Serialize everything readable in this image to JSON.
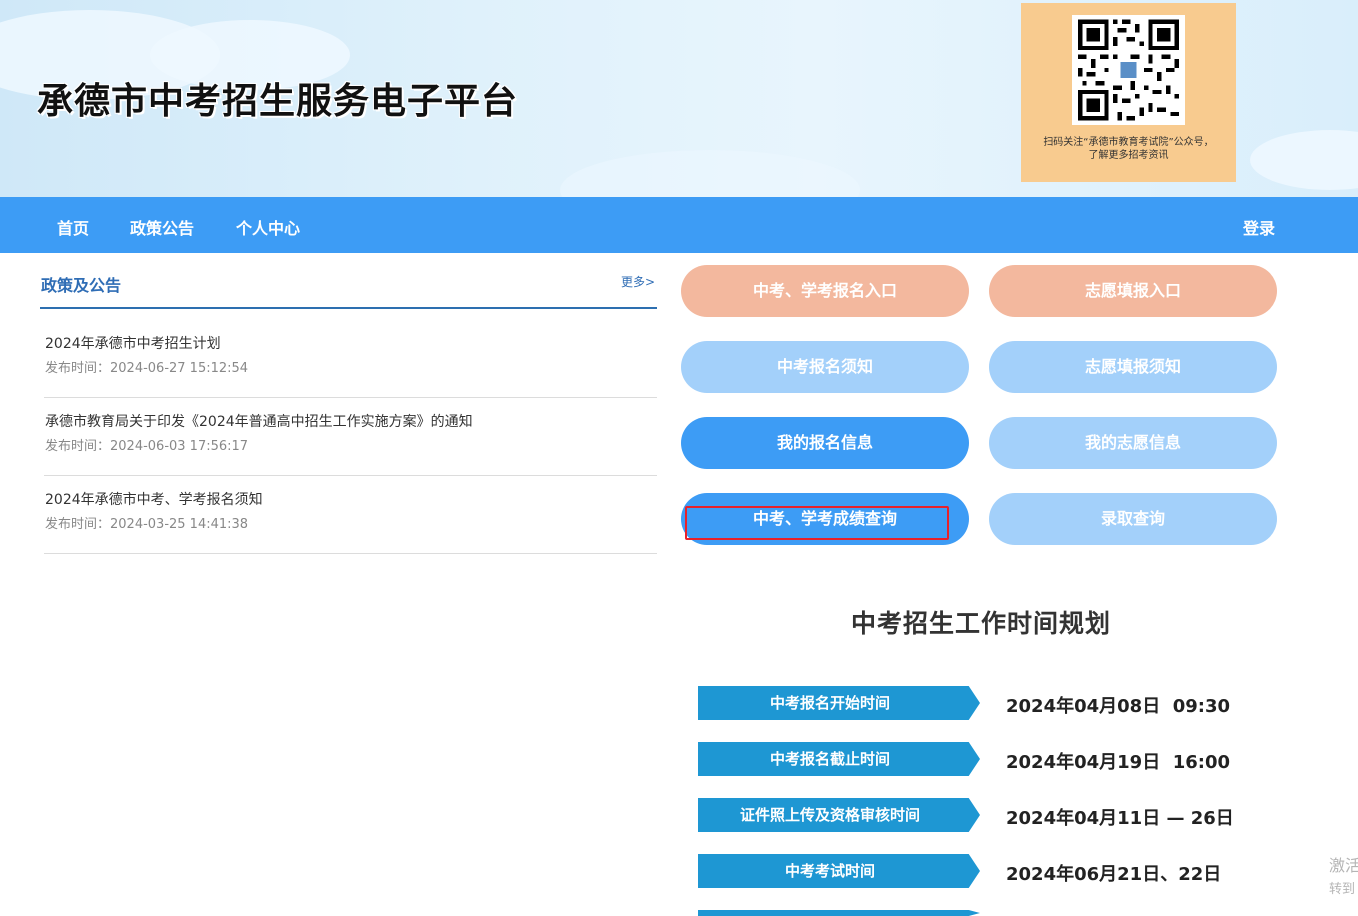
{
  "site": {
    "title": "承德市中考招生服务电子平台",
    "qr_caption_line1": "扫码关注“承德市教育考试院”公众号，",
    "qr_caption_line2": "了解更多招考资讯"
  },
  "nav": {
    "items": [
      {
        "label": "首页"
      },
      {
        "label": "政策公告"
      },
      {
        "label": "个人中心"
      }
    ],
    "login": "登录"
  },
  "news": {
    "heading": "政策及公告",
    "more": "更多>",
    "items": [
      {
        "title": "2024年承德市中考招生计划",
        "time": "发布时间：2024-06-27 15:12:54"
      },
      {
        "title": "承德市教育局关于印发《2024年普通高中招生工作实施方案》的通知",
        "time": "发布时间：2024-06-03 17:56:17"
      },
      {
        "title": "2024年承德市中考、学考报名须知",
        "time": "发布时间：2024-03-25 14:41:38"
      }
    ]
  },
  "actions": {
    "register_entry": "中考、学考报名入口",
    "volunteer_entry": "志愿填报入口",
    "register_notice": "中考报名须知",
    "volunteer_notice": "志愿填报须知",
    "my_registration": "我的报名信息",
    "my_volunteer": "我的志愿信息",
    "score_query": "中考、学考成绩查询",
    "admission_query": "录取查询"
  },
  "schedule": {
    "title": "中考招生工作时间规划",
    "rows": [
      {
        "label": "中考报名开始时间",
        "value": "2024年04月08日  09:30"
      },
      {
        "label": "中考报名截止时间",
        "value": "2024年04月19日  16:00"
      },
      {
        "label": "证件照上传及资格审核时间",
        "value": "2024年04月11日 — 26日"
      },
      {
        "label": "中考考试时间",
        "value": "2024年06月21日、22日"
      }
    ]
  },
  "watermark": {
    "line1": "激活",
    "line2": "转到"
  },
  "colors": {
    "nav_blue": "#3d9cf5",
    "peach": "#f3b89e",
    "light_blue": "#a3d0fa",
    "tag_blue": "#1e97d3",
    "highlight_red": "#e8212b"
  }
}
